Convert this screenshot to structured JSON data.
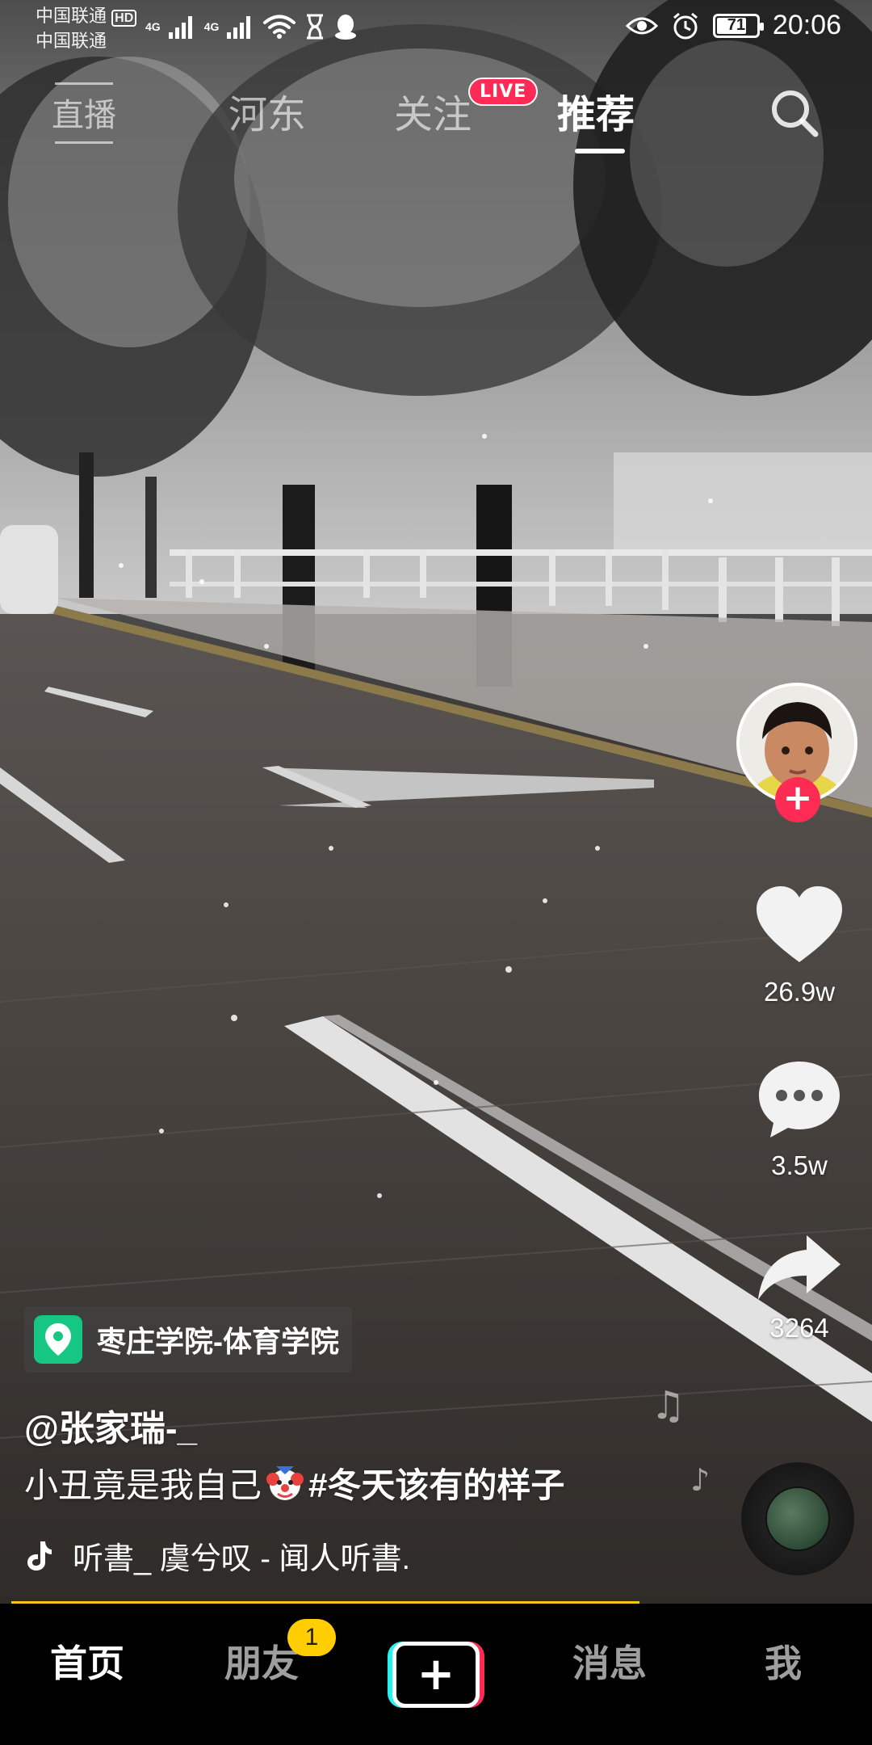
{
  "status_bar": {
    "carrier_1": "中国联通",
    "carrier_1_badge": "HD",
    "carrier_2": "中国联通",
    "network_1": "4G",
    "network_2": "4G",
    "battery_level": "71",
    "time": "20:06"
  },
  "top_tabs": {
    "live": "直播",
    "city": "河东",
    "following": "关注",
    "following_badge": "LIVE",
    "recommended": "推荐",
    "active": "推荐"
  },
  "rail": {
    "follow_plus": "+",
    "likes": "26.9w",
    "comments": "3.5w",
    "shares": "3264"
  },
  "video_info": {
    "location": "枣庄学院-体育学院",
    "author": "@张家瑞-_",
    "caption_text": "小丑竟是我自己",
    "caption_hashtag": "#冬天该有的样子",
    "music": "听書_   虞兮叹 - 闻人听書."
  },
  "bottom_nav": {
    "home": "首页",
    "friends": "朋友",
    "friends_badge": "1",
    "create": "+",
    "messages": "消息",
    "me": "我",
    "active": "首页"
  },
  "colors": {
    "accent_red": "#fe2c55",
    "accent_cyan": "#25f4ee",
    "badge_yellow": "#ffcd00",
    "location_green": "#16c784",
    "progress_yellow": "#f5c518"
  },
  "icons": [
    "hd-icon",
    "signal-icon",
    "wifi-icon",
    "hourglass-icon",
    "qq-icon",
    "eye-icon",
    "alarm-icon",
    "battery-icon",
    "search-icon",
    "heart-icon",
    "comment-icon",
    "share-icon",
    "location-pin-icon",
    "music-note-icon",
    "tiktok-note-icon",
    "music-disc-icon",
    "clown-emoji-icon"
  ]
}
